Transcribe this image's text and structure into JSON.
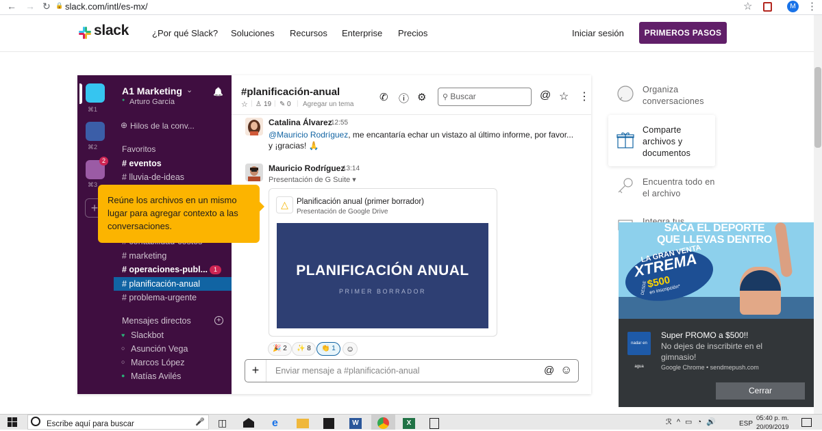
{
  "browser": {
    "back": "←",
    "forward": "→",
    "reload": "↻",
    "lock": "🔒",
    "url": "slack.com/intl/es-mx/",
    "star": "☆",
    "profile_initial": "M",
    "menu": "⋮"
  },
  "header": {
    "logo": "slack",
    "nav": [
      "¿Por qué Slack?",
      "Soluciones",
      "Recursos",
      "Enterprise",
      "Precios"
    ],
    "login": "Iniciar sesión",
    "cta": "PRIMEROS PASOS"
  },
  "app": {
    "workspace": {
      "name": "A1 Marketing",
      "chevron": "⌄",
      "user": "Arturo García",
      "bell": "🔔",
      "shortcuts": [
        "⌘1",
        "⌘2",
        "⌘3"
      ],
      "badge": "2",
      "add": "+"
    },
    "sidebar": {
      "threads": "Hilos de la conv...",
      "favorites_header": "Favoritos",
      "channels_top": [
        {
          "name": "# eventos",
          "bold": true
        },
        {
          "name": "# lluvia-de-ideas",
          "bold": false
        }
      ],
      "partial_channel": "# contabilidad-costos",
      "channels": [
        {
          "name": "# marketing",
          "bold": false
        },
        {
          "name": "# operaciones-publ...",
          "bold": true,
          "badge": "1"
        },
        {
          "name": "# planificación-anual",
          "active": true
        },
        {
          "name": "# problema-urgente",
          "bold": false
        }
      ],
      "dm_header": "Mensajes directos",
      "dm_add": "+",
      "dms": [
        {
          "status": "♥",
          "name": "Slackbot"
        },
        {
          "status": "○",
          "name": "Asunción Vega"
        },
        {
          "status": "○",
          "name": "Marcos López"
        },
        {
          "status": "●",
          "name": "Matías Avilés"
        }
      ]
    },
    "tooltip": "Reúne los archivos en un mismo lugar para agregar contexto a las conversaciones.",
    "channel": {
      "name": "#planificación-anual",
      "star": "☆",
      "members": "19",
      "pins": "0",
      "topic": "Agregar un tema",
      "search_placeholder": "Buscar",
      "icons": {
        "phone": "✆",
        "info": "ⓘ",
        "settings": "⚙",
        "mention": "@",
        "star": "☆",
        "more": "⋮"
      }
    },
    "messages": [
      {
        "author": "Catalina Álvarez",
        "time": "12:55",
        "mention": "@Mauricio Rodríguez",
        "text": ", me encantaría echar un vistazo al último informe, por favor...",
        "text2": "y ¡gracias! 🙏"
      },
      {
        "author": "Mauricio Rodríguez",
        "time": "13:14",
        "subtitle": "Presentación de G Suite ▾",
        "file_title": "Planificación anual (primer borrador)",
        "file_source": "Presentación de Google Drive",
        "slide_title": "PLANIFICACIÓN ANUAL",
        "slide_subtitle": "PRIMER BORRADOR",
        "reactions": [
          {
            "emoji": "🎉",
            "count": "2"
          },
          {
            "emoji": "✨",
            "count": "8"
          },
          {
            "emoji": "👏",
            "count": "1",
            "active": true
          }
        ],
        "add_reaction": "☺"
      }
    ],
    "composer": {
      "plus": "+",
      "placeholder": "Enviar mensaje a #planificación-anual",
      "mention": "@",
      "emoji": "☺"
    }
  },
  "features": [
    {
      "label": "Organiza conversaciones",
      "icon": "chat-bubble-icon"
    },
    {
      "label": "Comparte archivos y documentos",
      "icon": "gift-file-icon"
    },
    {
      "label": "Encuentra todo en el archivo",
      "icon": "search-key-icon"
    },
    {
      "label": "Integra tus",
      "icon": "integration-icon"
    }
  ],
  "ad": {
    "headline": "SACA EL DEPORTE QUE LLEVAS DENTRO",
    "badge_top": "LA GRAN VENTA",
    "badge_main": "XTREMA",
    "badge_desde": "DESDE",
    "badge_price": "$500",
    "badge_sub": "en inscripción*",
    "logo_text": "nadar en agua",
    "title": "Super PROMO a $500!!",
    "body": "No dejes de inscribirte en el gimnasio!",
    "source": "Google Chrome • sendmepush.com",
    "close": "Cerrar"
  },
  "taskbar": {
    "search": "Escribe aquí para buscar",
    "mic": "🎤",
    "time": "05:40 p. m.",
    "date": "20/09/2019",
    "lang": "ESP",
    "tray": "ℛ  ^  ▭  ◔  🔊"
  }
}
